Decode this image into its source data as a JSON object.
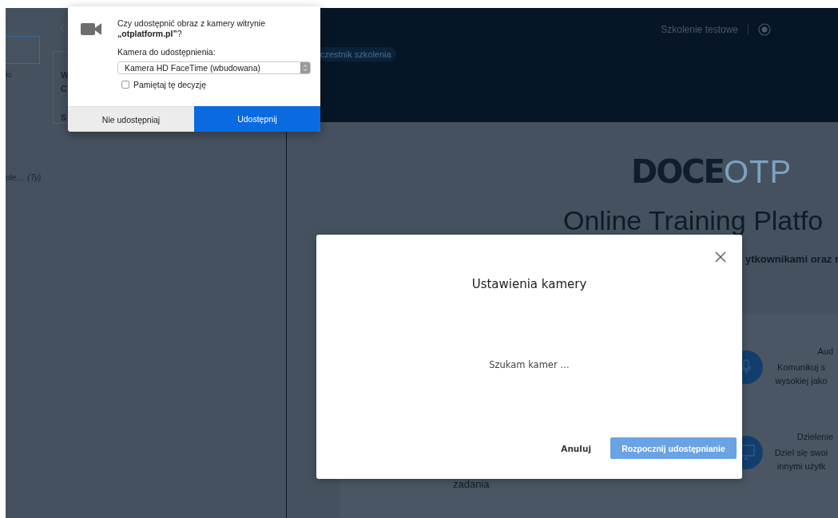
{
  "left_panel": {
    "card_lines": [
      "W",
      "C",
      "S"
    ],
    "items": [
      {
        "text": "ki"
      },
      {
        "text": "ole…",
        "note": "(Ty)"
      }
    ]
  },
  "header": {
    "training_name": "Szkolenie testowe",
    "role_badge": "czestnik szkolenia"
  },
  "hero": {
    "logo_bold": "DOCE",
    "logo_light": "OTP",
    "title": "Online Training Platfo",
    "subtitle": "ytkownikami oraz r"
  },
  "features_left_text": "zadania",
  "features": [
    {
      "kind": "audio",
      "title": "Aud",
      "lines": [
        "Komunikuj s",
        "wysokiej jako"
      ]
    },
    {
      "kind": "screen",
      "title": "Dzielenie",
      "lines": [
        "Dziel się swoi",
        "innymi użytk"
      ]
    }
  ],
  "modal": {
    "title": "Ustawienia kamery",
    "message": "Szukam kamer …",
    "cancel": "Anuluj",
    "confirm": {
      "label": "Rozpocznij udostępnianie",
      "disabled": true
    }
  },
  "permission_popup": {
    "question": "Czy udostępnić obraz z kamery witrynie **„otplatform.pl”**?",
    "camera_label": "Kamera do udostępnienia:",
    "camera_value": "Kamera HD FaceTime (wbudowana)",
    "remember": {
      "label": "Pamiętaj tę decyzję",
      "checked": false
    },
    "deny": "Nie udostępniaj",
    "allow": "Udostępnij"
  }
}
